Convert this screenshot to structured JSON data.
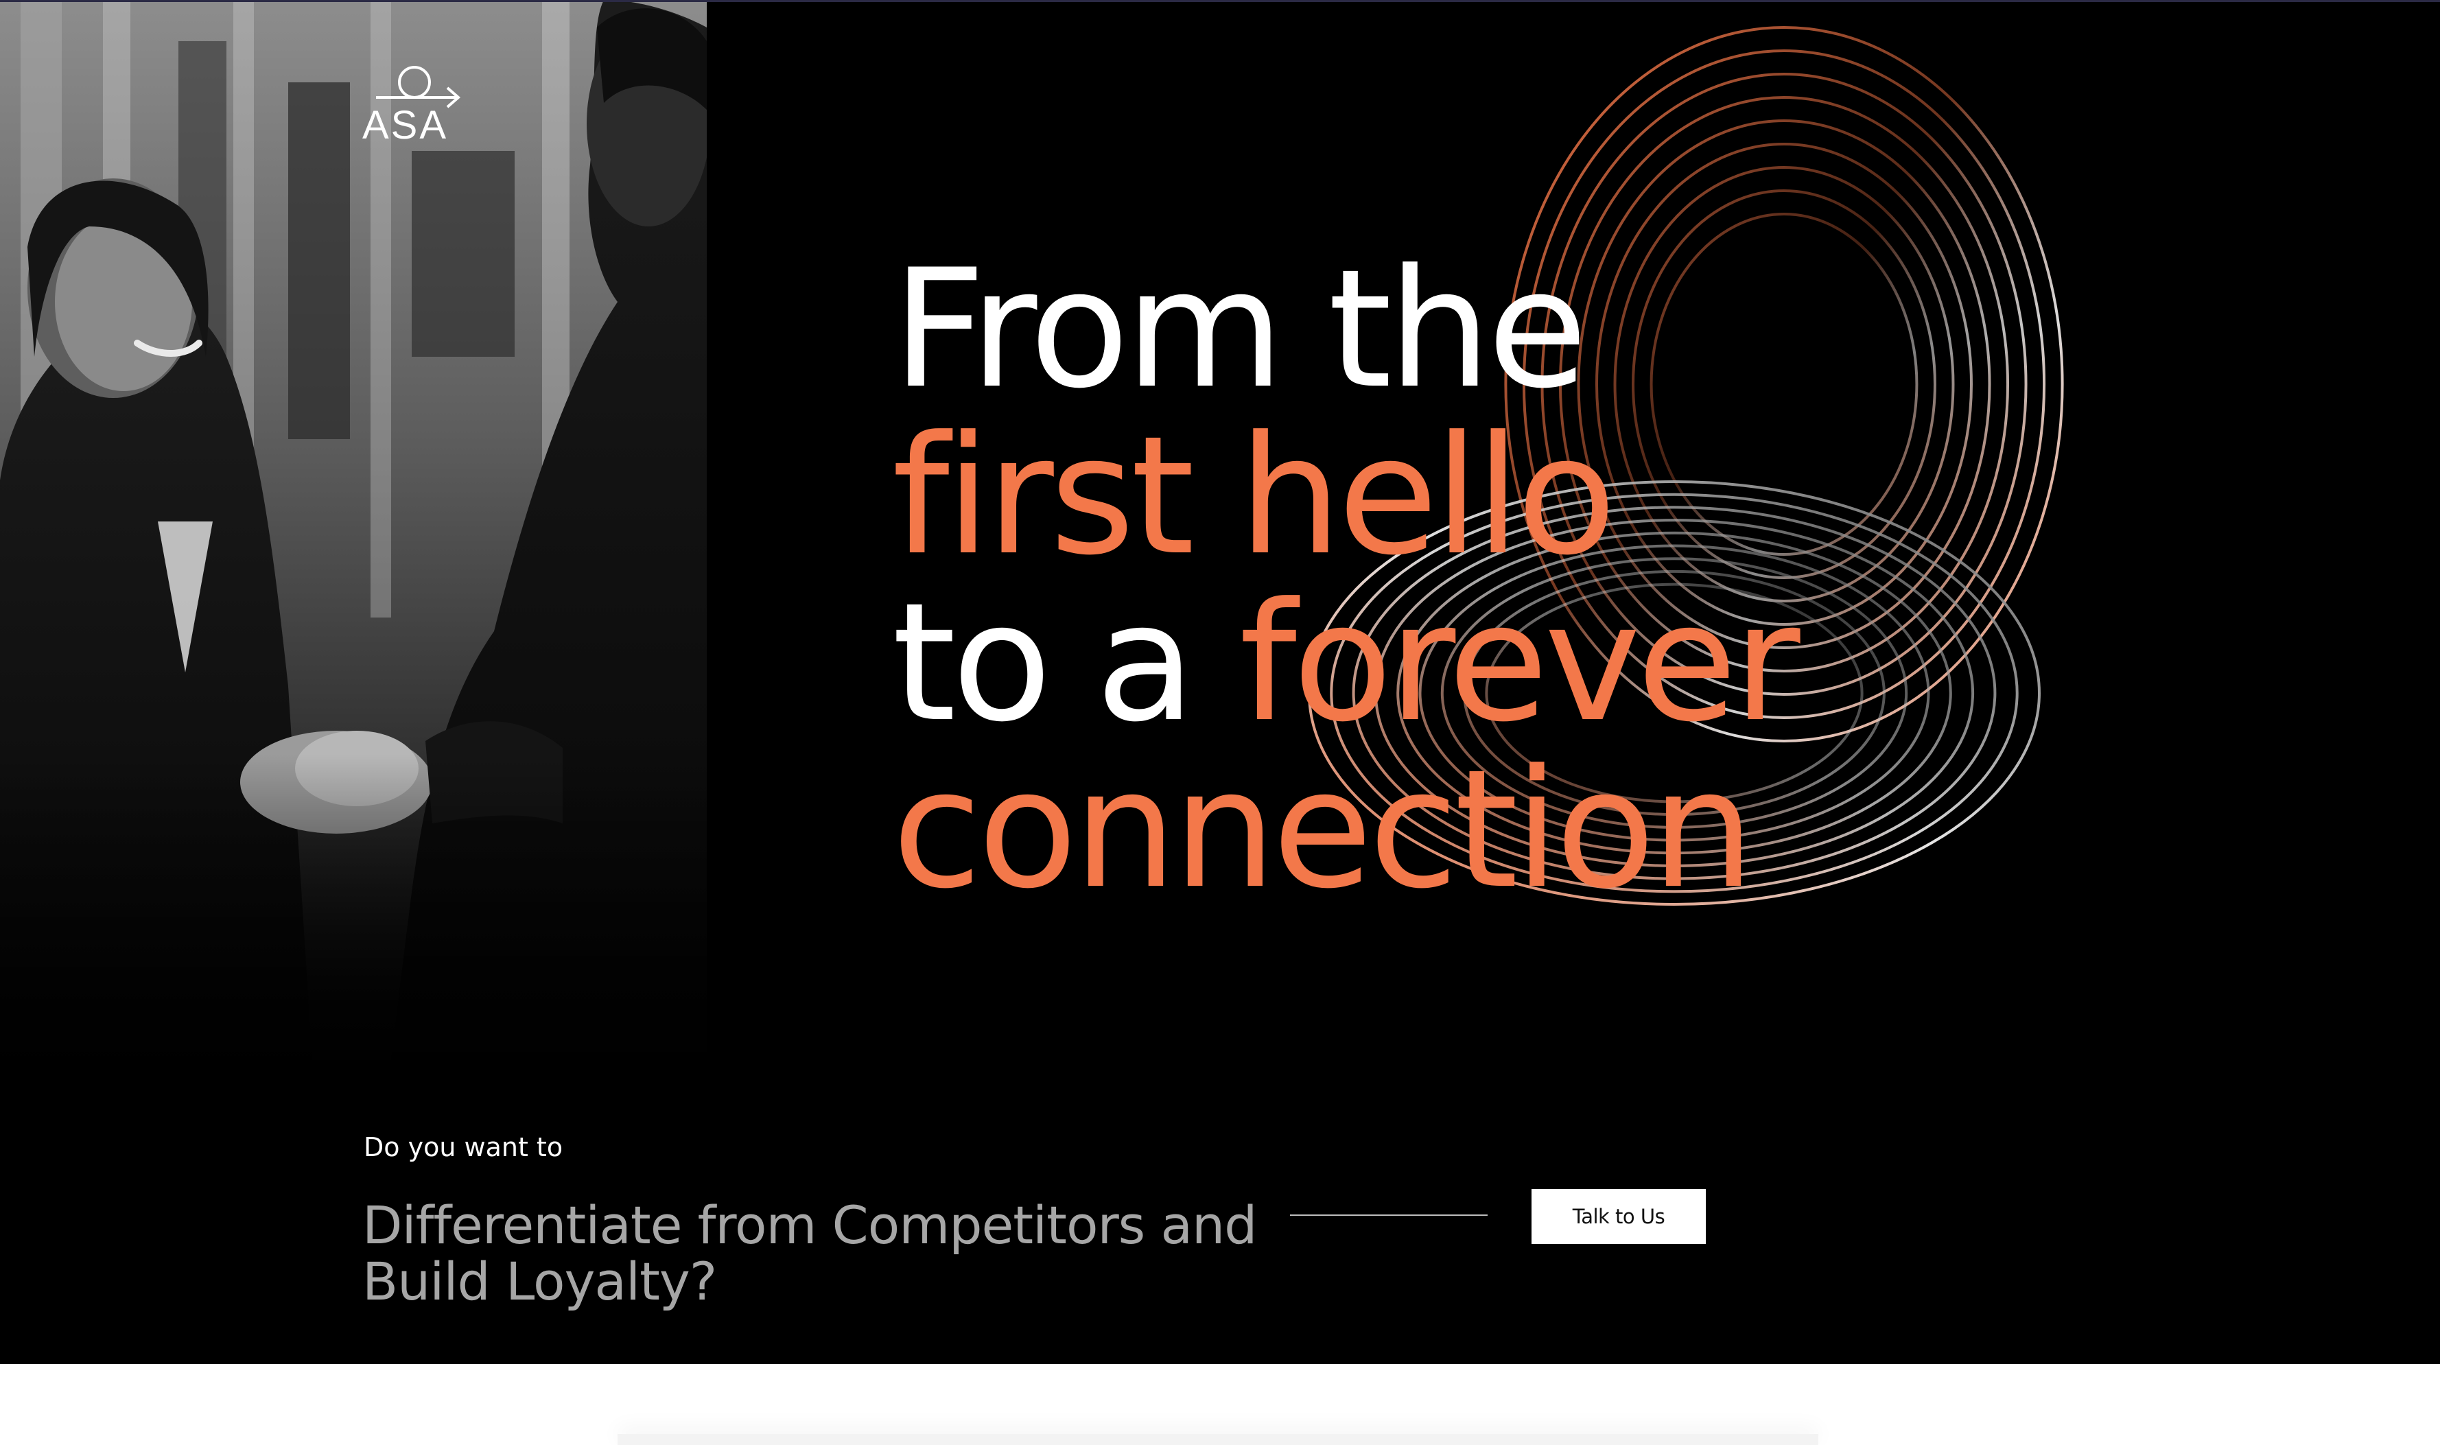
{
  "brand": {
    "logo_text": "ASA",
    "logo_mark": "circle-arrow-icon"
  },
  "hero": {
    "headline": {
      "line1": "From the",
      "line2": "first hello",
      "line3_plain": "to a ",
      "line3_accent": "forever",
      "line4": "connection"
    },
    "image": "handshake-photo"
  },
  "cta_strip": {
    "prompt": "Do you want to",
    "question": "Differentiate from Competitors and Build Loyalty?",
    "button_label": "Talk to Us"
  },
  "colors": {
    "background": "#000000",
    "accent": "#f3784a",
    "text": "#ffffff",
    "muted_text": "#a6a6a6"
  }
}
